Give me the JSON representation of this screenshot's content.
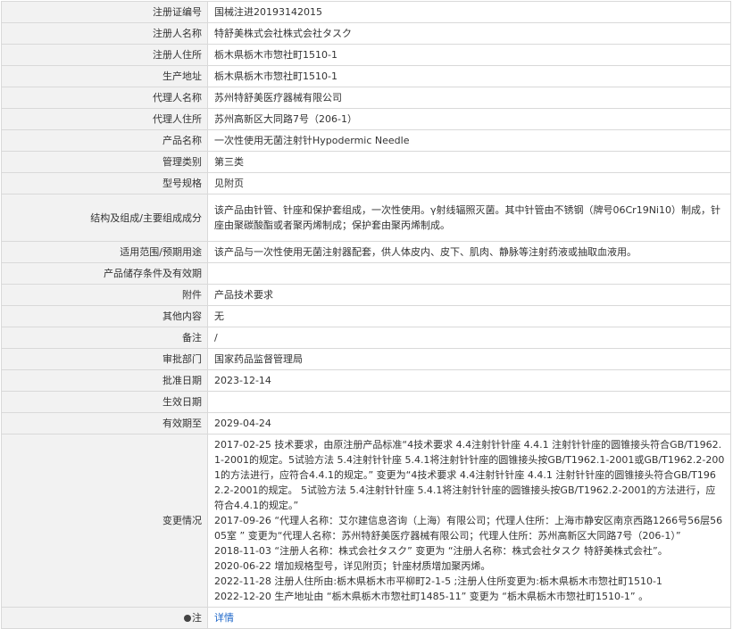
{
  "rows": [
    {
      "label": "注册证编号",
      "value": "国械注进20193142015"
    },
    {
      "label": "注册人名称",
      "value": "特舒美株式会社株式会社タスク"
    },
    {
      "label": "注册人住所",
      "value": "栃木県栃木市惣社町1510-1"
    },
    {
      "label": "生产地址",
      "value": "栃木県栃木市惣社町1510-1"
    },
    {
      "label": "代理人名称",
      "value": "苏州特舒美医疗器械有限公司"
    },
    {
      "label": "代理人住所",
      "value": "苏州高新区大同路7号（206-1）"
    },
    {
      "label": "产品名称",
      "value": "一次性使用无菌注射针Hypodermic Needle"
    },
    {
      "label": "管理类别",
      "value": "第三类"
    },
    {
      "label": "型号规格",
      "value": "见附页"
    },
    {
      "label": "结构及组成/主要组成成分",
      "value": "该产品由针管、针座和保护套组成，一次性使用。γ射线辐照灭菌。其中针管由不锈钢（牌号06Cr19Ni10）制成，针座由聚碳酸酯或者聚丙烯制成；保护套由聚丙烯制成。"
    },
    {
      "label": "适用范围/预期用途",
      "value": "该产品与一次性使用无菌注射器配套，供人体皮内、皮下、肌肉、静脉等注射药液或抽取血液用。"
    },
    {
      "label": "产品储存条件及有效期",
      "value": ""
    },
    {
      "label": "附件",
      "value": "产品技术要求"
    },
    {
      "label": "其他内容",
      "value": "无"
    },
    {
      "label": "备注",
      "value": "/"
    },
    {
      "label": "审批部门",
      "value": "国家药品监督管理局"
    },
    {
      "label": "批准日期",
      "value": "2023-12-14"
    },
    {
      "label": "生效日期",
      "value": ""
    },
    {
      "label": "有效期至",
      "value": "2029-04-24"
    }
  ],
  "changes": {
    "label": "变更情况",
    "lines": [
      "2017-02-25 技术要求，由原注册产品标准“4技术要求 4.4注射针针座 4.4.1 注射针针座的圆锥接头符合GB/T1962.1-2001的规定。5试验方法 5.4注射针针座 5.4.1将注射针针座的圆锥接头按GB/T1962.1-2001或GB/T1962.2-2001的方法进行，应符合4.4.1的规定。” 变更为“4技术要求 4.4注射针针座 4.4.1 注射针针座的圆锥接头符合GB/T1962.2-2001的规定。 5试验方法 5.4注射针针座 5.4.1将注射针针座的圆锥接头按GB/T1962.2-2001的方法进行，应符合4.4.1的规定。”",
      "2017-09-26 “代理人名称：艾尔建信息咨询（上海）有限公司；代理人住所：上海市静安区南京西路1266号56层5605室 ” 变更为“代理人名称：苏州特舒美医疗器械有限公司；代理人住所：苏州高新区大同路7号（206-1）”",
      "2018-11-03 “注册人名称：株式会社タスク” 变更为 “注册人名称：株式会社タスク 特舒美株式会社”。",
      "2020-06-22 增加规格型号，详见附页；针座材质增加聚丙烯。",
      "2022-11-28 注册人住所由:栃木県栃木市平柳町2-1-5 ;注册人住所变更为:栃木県栃木市惣社町1510-1",
      "2022-12-20 生产地址由 “栃木県栃木市惣社町1485-11” 变更为 “栃木県栃木市惣社町1510-1” 。"
    ]
  },
  "note": {
    "label": "注",
    "link": "详情"
  }
}
